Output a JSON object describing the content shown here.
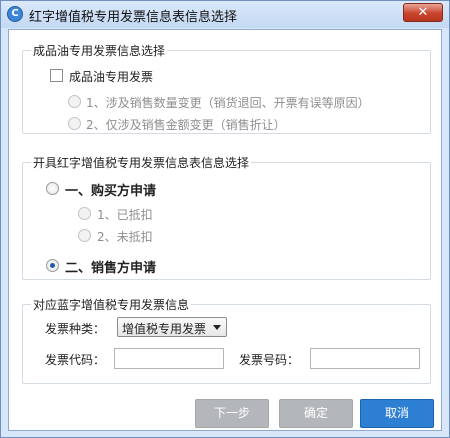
{
  "window": {
    "title": "红字增值税专用发票信息表信息选择",
    "close_glyph": "✕",
    "app_icon_glyph": "C"
  },
  "oil_group": {
    "title": "成品油专用发票信息选择",
    "checkbox_label": "成品油专用发票",
    "checkbox_checked": false,
    "options": [
      {
        "label": "1、涉及销售数量变更（销货退回、开票有误等原因）",
        "selected": false,
        "enabled": false
      },
      {
        "label": "2、仅涉及销售金额变更（销售折让）",
        "selected": false,
        "enabled": false
      }
    ]
  },
  "issue_group": {
    "title": "开具红字增值税专用发票信息表信息选择",
    "buyer": {
      "label": "一、购买方申请",
      "selected": false
    },
    "buyer_options": [
      {
        "label": "1、已抵扣",
        "selected": false,
        "enabled": false
      },
      {
        "label": "2、未抵扣",
        "selected": false,
        "enabled": false
      }
    ],
    "seller": {
      "label": "二、销售方申请",
      "selected": true
    }
  },
  "blue_group": {
    "title": "对应蓝字增值税专用发票信息",
    "type_label": "发票种类：",
    "type_value": "增值税专用发票",
    "code_label": "发票代码：",
    "code_value": "",
    "number_label": "发票号码：",
    "number_value": ""
  },
  "buttons": {
    "next": "下一步",
    "ok": "确定",
    "cancel": "取消"
  },
  "colors": {
    "primary_button": "#2d7fd4",
    "disabled_button": "#b3b6ba",
    "radio_dot": "#1e5ca8",
    "close_button": "#c9442d"
  }
}
